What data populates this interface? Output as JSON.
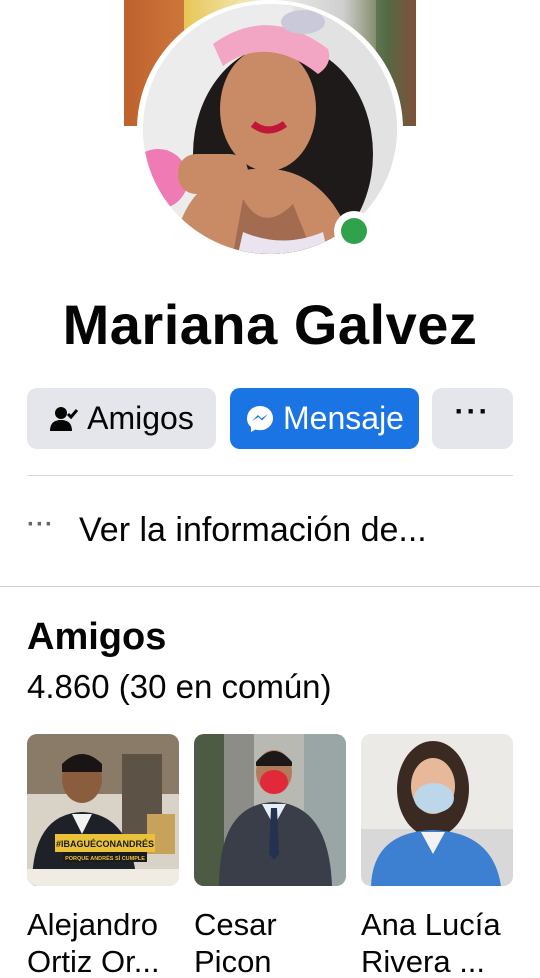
{
  "profile": {
    "name": "Mariana Galvez",
    "online_status_color": "#31a24c"
  },
  "actions": {
    "friends_label": "Amigos",
    "friends_icon": "person-check-icon",
    "message_label": "Mensaje",
    "message_icon": "messenger-icon",
    "more_label": "···",
    "accent_color": "#1b74e4"
  },
  "info": {
    "dots": "···",
    "text": "Ver la información de..."
  },
  "friends_section": {
    "title": "Amigos",
    "count": "4.860 (30 en común)",
    "items": [
      {
        "name": "Alejandro\nOrtiz Or...",
        "banner": "#IBAGUÉCONANDRÉS",
        "banner_sub": "PORQUE ANDRÉS SÍ CUMPLE"
      },
      {
        "name": "Cesar\nPicon"
      },
      {
        "name": "Ana Lucía\nRivera ..."
      }
    ]
  }
}
